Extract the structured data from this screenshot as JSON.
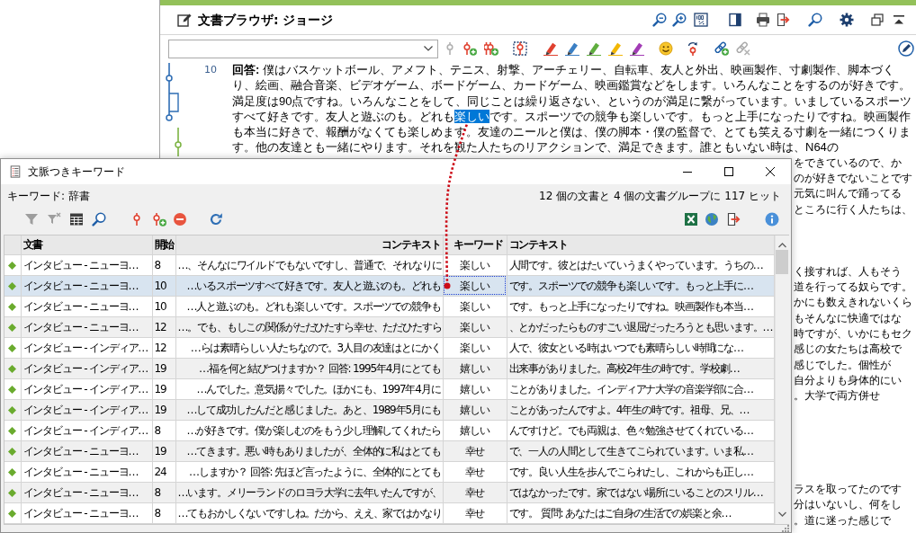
{
  "document_browser": {
    "title": "文書ブラウザ: ジョージ",
    "toolbar": [
      {
        "disabled": true
      },
      {
        "disabled": false
      },
      {
        "disabled": false
      },
      {
        "disabled": false
      },
      {
        "disabled": false
      },
      {
        "disabled": false
      },
      {
        "disabled": false
      },
      {
        "disabled": false
      },
      {
        "disabled": false
      },
      {
        "disabled": false
      },
      {
        "disabled": false
      },
      {
        "disabled": false
      },
      {
        "disabled": true
      }
    ],
    "paragraph": {
      "number": "10",
      "segments": [
        {
          "text": "**回答:** 僕はバスケットボール、アメフト、テニス、射撃、アーチェリー、自転車、友人と外出、映画製作、寸劇製作、脚本づくり、絵画、融合音楽、ビデオゲーム、ボードゲーム、カードゲーム、映画鑑賞などをします。いろんなことをするのが好きです。満足度は90点ですね。いろんなことをして、同じことは繰り返さない、というのが満足に繋がっています。いましているスポーツすべて好きです。友人と遊ぶのも。どれも",
          "selected": false
        },
        {
          "text": "楽しい",
          "selected": true
        },
        {
          "text": "です。スポーツでの競争も楽しいです。もっと上手になったりですね。映画製作も本当に好きで、報酬がなくても楽しめます。友達のニールと僕は、僕の脚本・僕の監督で、とても笑える寸劇を一緒につくります。他の友達とも一緒にやります。それを観た人たちのリアクションで、満足できます。誰ともいない時は、N64の",
          "selected": false
        }
      ]
    },
    "covered_lines": [
      [
        "をできているので、か",
        "のが好きでないことです",
        "元気に叫んで踊ってる",
        "ところに行く人たちは、"
      ],
      [
        "く接すれば、人もそう",
        "道を行ってる奴らです。",
        "かにも数えきれないくら",
        "もそんなに快適ではな",
        "時ですが、いかにもセク",
        "感じの女たちは高校で",
        "感じでした。個性が",
        "自分よりも身体的にい",
        "。大学で両方併せ"
      ],
      [
        "ラスを取ってたのです",
        "分はいないし、何をし",
        "。道に迷った感じで"
      ]
    ]
  },
  "kwic_window": {
    "title": "文脈つきキーワード",
    "keyword_label": "キーワード: 辞書",
    "hit_summary": "12 個の文書と 4 個の文書グループに 117 ヒット",
    "toolbar": [
      {
        "disabled": true
      },
      {
        "disabled": true
      },
      {
        "disabled": false
      },
      {
        "disabled": false
      },
      {
        "disabled": false
      },
      {
        "disabled": false
      },
      {
        "disabled": false
      },
      {
        "disabled": false
      },
      {
        "disabled": false
      },
      {
        "disabled": false
      },
      {
        "disabled": false
      },
      {
        "disabled": false
      }
    ],
    "table": {
      "columns": [
        "文書",
        "開始",
        "コンテキスト",
        "キーワード",
        "コンテキスト"
      ],
      "rows": [
        {
          "document": "インタビュー - ニューヨ…",
          "start": "8",
          "context_before": "…、そんなにワイルドでもないですし、普通で、それなりに",
          "keyword": "楽しい",
          "context_after": "人間です。彼とはたいていうまくやっています。うちの…",
          "selected": false
        },
        {
          "document": "インタビュー - ニューヨ…",
          "start": "10",
          "context_before": "…いるスポーツすべて好きです。友人と遊ぶのも。どれも",
          "keyword": "楽しい",
          "context_after": "です。スポーツでの競争も楽しいです。もっと上手に…",
          "selected": true
        },
        {
          "document": "インタビュー - ニューヨ…",
          "start": "10",
          "context_before": "…人と遊ぶのも。どれも楽しいです。スポーツでの競争も",
          "keyword": "楽しい",
          "context_after": "です。もっと上手になったりですね。映画製作も本当…",
          "selected": false
        },
        {
          "document": "インタビュー - ニューヨ…",
          "start": "12",
          "context_before": "…。でも、もしこの関係がただひたすら幸せ、ただひたすら",
          "keyword": "楽しい",
          "context_after": "、とかだったらものすごい退屈だったろうとも思います。…",
          "selected": false
        },
        {
          "document": "インタビュー - インディア…",
          "start": "12",
          "context_before": "…らは素晴らしい人たちなので。3人目の友達はとにかく",
          "keyword": "楽しい",
          "context_after": "人で、彼女といる時はいつでも素晴らしい時間にな…",
          "selected": false
        },
        {
          "document": "インタビュー - インディア…",
          "start": "19",
          "context_before": "…福を何と結びつけますか？ 回答: 1995年4月にとても",
          "keyword": "嬉しい",
          "context_after": "出来事がありました。高校2年生の時です。学校劇…",
          "selected": false
        },
        {
          "document": "インタビュー - インディア…",
          "start": "19",
          "context_before": "…んでした。意気揚々でした。ほかにも、1997年4月に",
          "keyword": "嬉しい",
          "context_after": "ことがありました。インディアナ大学の音楽学部に合…",
          "selected": false
        },
        {
          "document": "インタビュー - インディア…",
          "start": "19",
          "context_before": "…して成功したんだと感じました。あと、1989年5月にも",
          "keyword": "嬉しい",
          "context_after": "ことがあったんですよ。4年生の時です。祖母、兄、…",
          "selected": false
        },
        {
          "document": "インタビュー - インディア…",
          "start": "8",
          "context_before": "…が好きです。僕が楽しむのをもう少し理解してくれたら",
          "keyword": "嬉しい",
          "context_after": "んですけど。でも両親は、色々勉強させてくれている…",
          "selected": false
        },
        {
          "document": "インタビュー - ニューヨ…",
          "start": "19",
          "context_before": "…てきます。悪い時もありましたが、全体的に私はとても",
          "keyword": "幸せ",
          "context_after": "で、一人の人間として生きてこられています。いま私…",
          "selected": false
        },
        {
          "document": "インタビュー - ニューヨ…",
          "start": "24",
          "context_before": "…しますか？ 回答: 先ほど言ったように、全体的にとても",
          "keyword": "幸せ",
          "context_after": "です。良い人生を歩んでこられたし、これからも正し…",
          "selected": false
        },
        {
          "document": "インタビュー - ニューヨ…",
          "start": "8",
          "context_before": "…います。メリーランドのロヨラ大学に去年いたんですが、",
          "keyword": "幸せ",
          "context_after": "ではなかったです。家ではない場所にいることのスリル…",
          "selected": false
        },
        {
          "document": "インタビュー - ニューヨ…",
          "start": "8",
          "context_before": "…てもおかしくないですしね。だから、ええ、家ではかなり",
          "keyword": "幸せ",
          "context_after": "です。 質問: あなたはご自身の生活での娯楽と余…",
          "selected": false
        }
      ]
    }
  }
}
